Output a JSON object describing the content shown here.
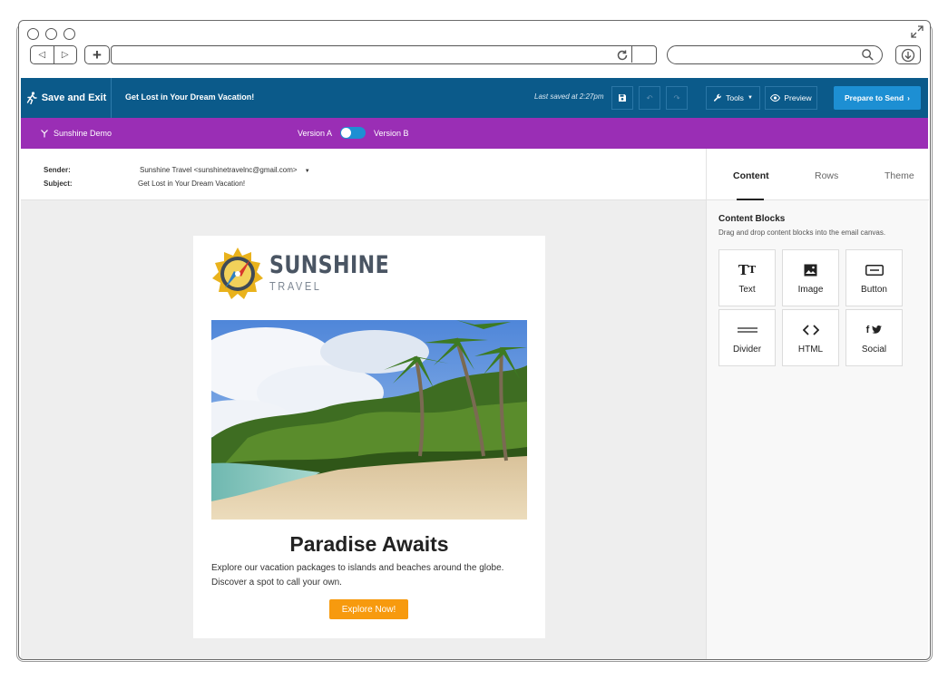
{
  "toolbar": {
    "save_exit": "Save and Exit",
    "doc_title": "Get Lost in Your Dream Vacation!",
    "last_saved": "Last saved at 2:27pm",
    "tools": "Tools",
    "preview": "Preview",
    "prepare": "Prepare to Send"
  },
  "abbar": {
    "demo": "Sunshine Demo",
    "version_a": "Version A",
    "version_b": "Version B"
  },
  "header": {
    "sender_label": "Sender:",
    "sender_value": "Sunshine Travel <sunshinetravelnc@gmail.com>",
    "subject_label": "Subject:",
    "subject_value": "Get Lost in Your Dream Vacation!"
  },
  "email": {
    "logo_line1": "SUNSHINE",
    "logo_line2": "TRAVEL",
    "headline": "Paradise Awaits",
    "copy": "Explore our vacation packages to islands and beaches around the globe. Discover a spot to call your own.",
    "cta": "Explore Now!"
  },
  "panel": {
    "tabs": [
      "Content",
      "Rows",
      "Theme"
    ],
    "blocks_title": "Content Blocks",
    "blocks_sub": "Drag and drop content blocks into the email canvas.",
    "blocks": [
      "Text",
      "Image",
      "Button",
      "Divider",
      "HTML",
      "Social"
    ]
  },
  "colors": {
    "toolbar": "#0b5a8a",
    "abbar": "#9a2eb5",
    "primary": "#1d8fd3",
    "cta": "#f79a0e"
  }
}
